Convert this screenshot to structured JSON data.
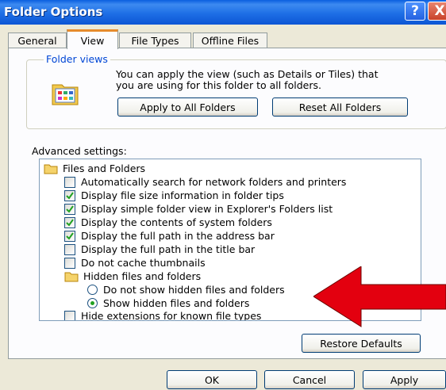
{
  "window": {
    "title": "Folder Options"
  },
  "tabs": [
    {
      "label": "General",
      "active": false
    },
    {
      "label": "View",
      "active": true
    },
    {
      "label": "File Types",
      "active": false
    },
    {
      "label": "Offline Files",
      "active": false
    }
  ],
  "folder_views": {
    "legend": "Folder views",
    "description_line1": "You can apply the view (such as Details or Tiles) that",
    "description_line2": "you are using for this folder to all folders.",
    "apply_button": "Apply to All Folders",
    "reset_button": "Reset All Folders"
  },
  "advanced": {
    "label": "Advanced settings:",
    "items": [
      {
        "type": "folder",
        "text": "Files and Folders"
      },
      {
        "type": "checkbox",
        "text": "Automatically search for network folders and printers",
        "checked": false
      },
      {
        "type": "checkbox",
        "text": "Display file size information in folder tips",
        "checked": true
      },
      {
        "type": "checkbox",
        "text": "Display simple folder view in Explorer's Folders list",
        "checked": true
      },
      {
        "type": "checkbox",
        "text": "Display the contents of system folders",
        "checked": true
      },
      {
        "type": "checkbox",
        "text": "Display the full path in the address bar",
        "checked": true
      },
      {
        "type": "checkbox",
        "text": "Display the full path in the title bar",
        "checked": false
      },
      {
        "type": "checkbox",
        "text": "Do not cache thumbnails",
        "checked": false
      },
      {
        "type": "folder",
        "text": "Hidden files and folders"
      },
      {
        "type": "radio",
        "text": "Do not show hidden files and folders",
        "checked": false
      },
      {
        "type": "radio",
        "text": "Show hidden files and folders",
        "checked": true
      },
      {
        "type": "checkbox",
        "text": "Hide extensions for known file types",
        "checked": false
      }
    ]
  },
  "buttons": {
    "restore_defaults": "Restore Defaults",
    "ok": "OK",
    "cancel": "Cancel",
    "apply": "Apply"
  },
  "title_buttons": {
    "help": "?",
    "close": "X"
  },
  "colors": {
    "title_bar": "#0a5fe0",
    "tab_highlight": "#e68b2c",
    "arrow": "#e3000f",
    "group_legend": "#0046d5"
  }
}
